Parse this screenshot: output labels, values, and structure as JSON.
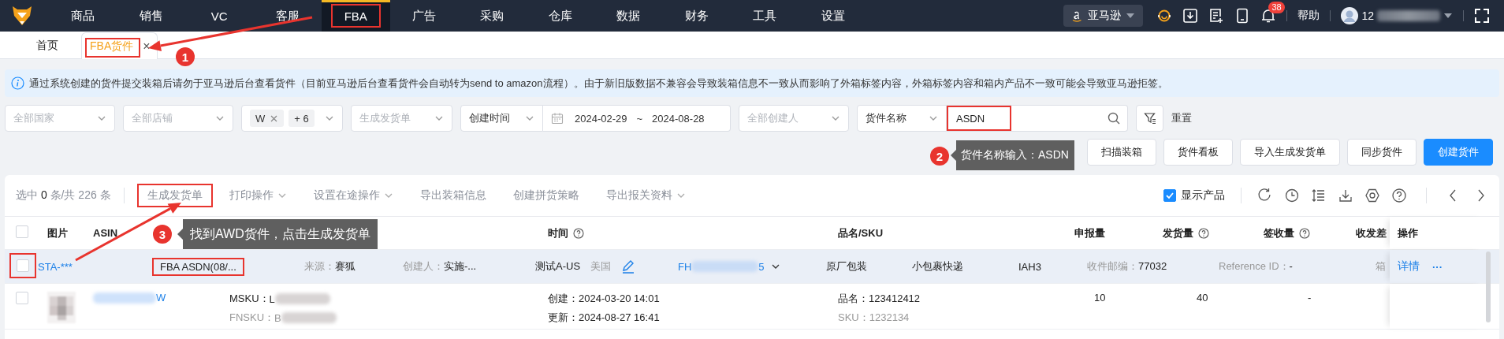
{
  "top_nav": {
    "menu": [
      {
        "label": "商品",
        "selected": false,
        "highlight": false
      },
      {
        "label": "销售",
        "selected": false,
        "highlight": false
      },
      {
        "label": "VC",
        "selected": false,
        "highlight": false
      },
      {
        "label": "客服",
        "selected": false,
        "highlight": false
      },
      {
        "label": "FBA",
        "selected": true,
        "highlight": true
      },
      {
        "label": "广告",
        "selected": false,
        "highlight": false
      },
      {
        "label": "采购",
        "selected": false,
        "highlight": false
      },
      {
        "label": "仓库",
        "selected": false,
        "highlight": false
      },
      {
        "label": "数据",
        "selected": false,
        "highlight": false
      },
      {
        "label": "财务",
        "selected": false,
        "highlight": false
      },
      {
        "label": "工具",
        "selected": false,
        "highlight": false
      },
      {
        "label": "设置",
        "selected": false,
        "highlight": false
      }
    ],
    "platform": "亚马逊",
    "notification_count": "38",
    "help": "帮助",
    "user": "12"
  },
  "page_tabs": [
    {
      "label": "首页",
      "selected": false,
      "highlight": false
    },
    {
      "label": "FBA货件",
      "selected": true,
      "highlight": true,
      "close": "×"
    }
  ],
  "notice": "通过系统创建的货件提交装箱后请勿于亚马逊后台查看货件（目前亚马逊后台查看货件会自动转为send to amazon流程）。由于新旧版数据不兼容会导致装箱信息不一致从而影响了外箱标签内容，外箱标签内容和箱内产品不一致可能会导致亚马逊拒签。",
  "filters": [
    {
      "kind": "select",
      "placeholder": "全部国家"
    },
    {
      "kind": "select",
      "placeholder": "全部店铺"
    },
    {
      "kind": "tags",
      "tags": [
        "W"
      ],
      "more": "+ 6"
    },
    {
      "kind": "select",
      "placeholder": "生成发货单"
    },
    {
      "kind": "select-joined",
      "value": "创建时间"
    },
    {
      "kind": "daterange",
      "start": "2024-02-29",
      "separator": "~",
      "end": "2024-08-28"
    },
    {
      "kind": "select",
      "placeholder": "全部创建人"
    },
    {
      "kind": "select-joined",
      "value": "货件名称"
    },
    {
      "kind": "search",
      "value": "ASDN",
      "highlight": true
    },
    {
      "kind": "filter-button"
    }
  ],
  "reset": "重置",
  "actions": [
    {
      "label": "扫描装箱",
      "kind": "default"
    },
    {
      "label": "货件看板",
      "kind": "default"
    },
    {
      "label": "导入生成发货单",
      "kind": "default"
    },
    {
      "label": "同步货件",
      "kind": "default"
    },
    {
      "label": "创建货件",
      "kind": "primary"
    }
  ],
  "table": {
    "selection": "选中 **0** 条/共 226 条",
    "toolbar_actions": [
      {
        "label": "生成发货单",
        "dropdown": false,
        "highlight": true
      },
      {
        "label": "打印操作",
        "dropdown": true,
        "highlight": false
      },
      {
        "label": "设置在途操作",
        "dropdown": true,
        "highlight": false
      },
      {
        "label": "导出装箱信息",
        "dropdown": false,
        "highlight": false
      },
      {
        "label": "创建拼货策略",
        "dropdown": false,
        "highlight": false
      },
      {
        "label": "导出报关资料",
        "dropdown": true,
        "highlight": false
      }
    ],
    "show_products": {
      "label": "显示产品",
      "checked": true
    },
    "select_all": {
      "checked": false
    },
    "columns": [
      {
        "label": "图片",
        "help": false
      },
      {
        "label": "ASIN",
        "help": false
      },
      {
        "label": "时间",
        "help": true
      },
      {
        "label": "品名/SKU",
        "help": false
      },
      {
        "label": "申报量",
        "help": false
      },
      {
        "label": "发货量",
        "help": true
      },
      {
        "label": "签收量",
        "help": true
      },
      {
        "label": "收发差",
        "help": false
      },
      {
        "label": "操作",
        "help": false
      }
    ],
    "shipment": {
      "checked": false,
      "checkbox_highlight": true,
      "id": "STA-***",
      "name": "FBA ASDN(08/...",
      "name_highlight": true,
      "source_label": "来源：",
      "source": "赛狐",
      "creator_label": "创建人：",
      "creator": "实施-...",
      "store": "测试A-US",
      "country": "美国",
      "fh_prefix": "FH",
      "fh_suffix": "5",
      "packing": "原厂包装",
      "shipping": "小包裹快递",
      "warehouse": "IAH3",
      "zip_label": "收件邮编：",
      "zip": "77032",
      "ref_label": "Reference ID：",
      "ref": "-",
      "box_label": "箱",
      "detail": "详情",
      "more": "···"
    },
    "product": {
      "checked": false,
      "asin_suffix": "W",
      "msku_label": "MSKU：",
      "msku": "L",
      "fnsku_label": "FNSKU：",
      "fnsku": "B",
      "created": "创建：2024-03-20 14:01",
      "updated": "更新：2024-08-27 16:41",
      "name": "品名：123412412",
      "sku": "SKU：1232134",
      "declared": "10",
      "shipped": "40",
      "received": "-"
    }
  },
  "annotations": [
    {
      "number": "1"
    },
    {
      "number": "2",
      "text": "货件名称输入：ASDN"
    },
    {
      "number": "3",
      "text": "找到AWD货件，点击生成发货单"
    }
  ]
}
